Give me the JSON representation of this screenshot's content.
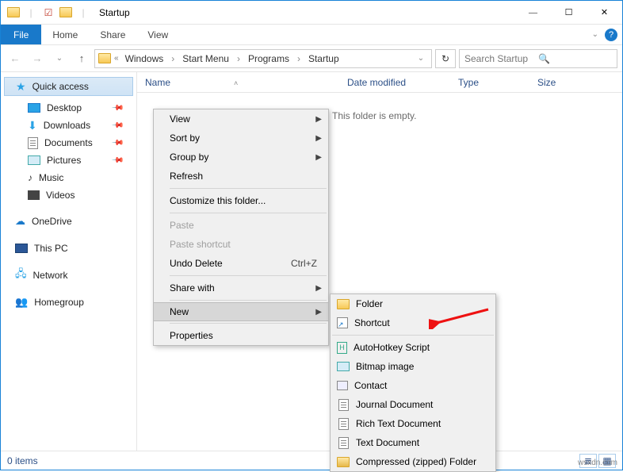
{
  "window": {
    "title": "Startup"
  },
  "ribbon": {
    "file": "File",
    "tabs": [
      "Home",
      "Share",
      "View"
    ]
  },
  "breadcrumbs": [
    "Windows",
    "Start Menu",
    "Programs",
    "Startup"
  ],
  "search": {
    "placeholder": "Search Startup"
  },
  "columns": {
    "name": "Name",
    "date": "Date modified",
    "type": "Type",
    "size": "Size"
  },
  "empty": "This folder is empty.",
  "sidebar": {
    "quick": "Quick access",
    "quick_items": [
      "Desktop",
      "Downloads",
      "Documents",
      "Pictures",
      "Music",
      "Videos"
    ],
    "onedrive": "OneDrive",
    "thispc": "This PC",
    "network": "Network",
    "homegroup": "Homegroup"
  },
  "ctx": {
    "view": "View",
    "sortby": "Sort by",
    "groupby": "Group by",
    "refresh": "Refresh",
    "customize": "Customize this folder...",
    "paste": "Paste",
    "paste_shortcut": "Paste shortcut",
    "undo_delete": "Undo Delete",
    "undo_key": "Ctrl+Z",
    "share": "Share with",
    "new": "New",
    "properties": "Properties"
  },
  "newmenu": {
    "items": [
      "Folder",
      "Shortcut",
      "AutoHotkey Script",
      "Bitmap image",
      "Contact",
      "Journal Document",
      "Rich Text Document",
      "Text Document",
      "Compressed (zipped) Folder"
    ]
  },
  "status": {
    "items": "0 items"
  },
  "watermark": "wsxdn.com"
}
